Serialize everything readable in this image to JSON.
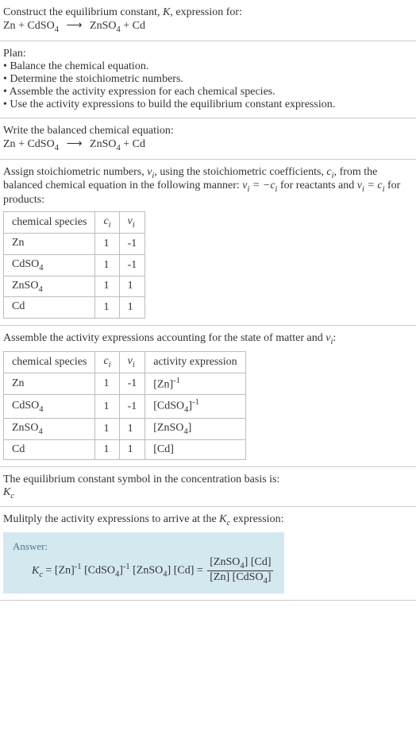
{
  "intro": {
    "line1_a": "Construct the equilibrium constant, ",
    "line1_b": ", expression for:"
  },
  "reaction": {
    "r1": "Zn",
    "plus": " + ",
    "r2a": "CdSO",
    "r2_sub": "4",
    "arrow": "⟶",
    "p1a": "ZnSO",
    "p1_sub": "4",
    "p2": "Cd"
  },
  "plan": {
    "title": "Plan:",
    "items": [
      "Balance the chemical equation.",
      "Determine the stoichiometric numbers.",
      "Assemble the activity expression for each chemical species.",
      "Use the activity expressions to build the equilibrium constant expression."
    ]
  },
  "balanced_intro": "Write the balanced chemical equation:",
  "stoich_intro_a": "Assign stoichiometric numbers, ",
  "stoich_intro_b": ", using the stoichiometric coefficients, ",
  "stoich_intro_c": ", from the balanced chemical equation in the following manner: ",
  "stoich_intro_d": " for reactants and ",
  "stoich_intro_e": " for products:",
  "table1": {
    "headers": {
      "h1": "chemical species"
    },
    "rows": [
      {
        "species": "Zn",
        "sub": "",
        "ci": "1",
        "vi": "-1"
      },
      {
        "species": "CdSO",
        "sub": "4",
        "ci": "1",
        "vi": "-1"
      },
      {
        "species": "ZnSO",
        "sub": "4",
        "ci": "1",
        "vi": "1"
      },
      {
        "species": "Cd",
        "sub": "",
        "ci": "1",
        "vi": "1"
      }
    ]
  },
  "activity_intro_a": "Assemble the activity expressions accounting for the state of matter and ",
  "activity_intro_b": ":",
  "table2": {
    "headers": {
      "h1": "chemical species",
      "h4": "activity expression"
    },
    "rows": [
      {
        "species": "Zn",
        "sub": "",
        "ci": "1",
        "vi": "-1",
        "act_base": "[Zn]",
        "act_sup": "-1"
      },
      {
        "species": "CdSO",
        "sub": "4",
        "ci": "1",
        "vi": "-1",
        "act_base": "[CdSO",
        "act_sub": "4",
        "act_close": "]",
        "act_sup": "-1"
      },
      {
        "species": "ZnSO",
        "sub": "4",
        "ci": "1",
        "vi": "1",
        "act_base": "[ZnSO",
        "act_sub": "4",
        "act_close": "]",
        "act_sup": ""
      },
      {
        "species": "Cd",
        "sub": "",
        "ci": "1",
        "vi": "1",
        "act_base": "[Cd]",
        "act_sup": ""
      }
    ]
  },
  "symbol_text": "The equilibrium constant symbol in the concentration basis is:",
  "multiply_text_a": "Mulitply the activity expressions to arrive at the ",
  "multiply_text_b": " expression:",
  "answer": {
    "label": "Answer:",
    "eq": " = ",
    "znso4": "[ZnSO",
    "znso4_sub": "4",
    "close": "]",
    "cd": " [Cd]",
    "zn": "[Zn]",
    "cdso4": " [CdSO",
    "cdso4_sub": "4"
  },
  "sym": {
    "K": "K",
    "Kc": "K",
    "c": "c",
    "vi": "ν",
    "i": "i",
    "ci": "c",
    "eq_neg": " = −",
    "eq": " = "
  },
  "chart_data": {
    "type": "table",
    "tables": [
      {
        "columns": [
          "chemical species",
          "c_i",
          "ν_i"
        ],
        "rows": [
          [
            "Zn",
            1,
            -1
          ],
          [
            "CdSO4",
            1,
            -1
          ],
          [
            "ZnSO4",
            1,
            1
          ],
          [
            "Cd",
            1,
            1
          ]
        ]
      },
      {
        "columns": [
          "chemical species",
          "c_i",
          "ν_i",
          "activity expression"
        ],
        "rows": [
          [
            "Zn",
            1,
            -1,
            "[Zn]^-1"
          ],
          [
            "CdSO4",
            1,
            -1,
            "[CdSO4]^-1"
          ],
          [
            "ZnSO4",
            1,
            1,
            "[ZnSO4]"
          ],
          [
            "Cd",
            1,
            1,
            "[Cd]"
          ]
        ]
      }
    ]
  }
}
